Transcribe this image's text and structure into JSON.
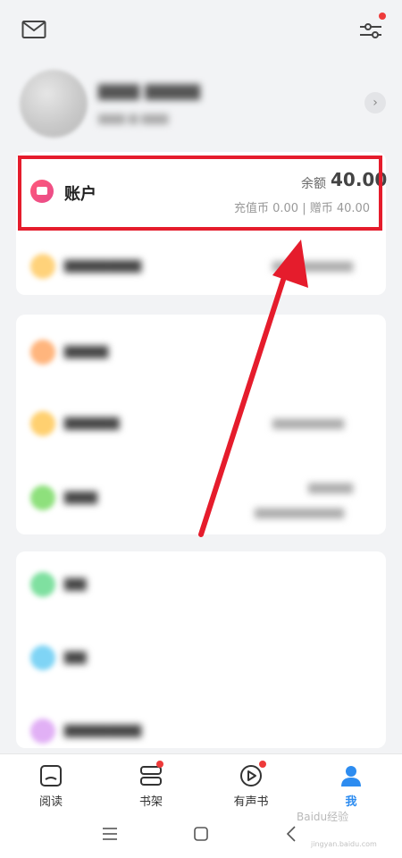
{
  "account": {
    "title": "账户",
    "balance_label": "余额",
    "balance_value": "40.00",
    "coins_text": "充值币 0.00 | 赠币 40.00"
  },
  "tabs": [
    {
      "label": "阅读",
      "icon": "book-icon",
      "badge": false,
      "active": false
    },
    {
      "label": "书架",
      "icon": "bookshelf-icon",
      "badge": true,
      "active": false
    },
    {
      "label": "有声书",
      "icon": "audiobook-play-icon",
      "badge": true,
      "active": false
    },
    {
      "label": "我",
      "icon": "person-icon",
      "badge": false,
      "active": true
    }
  ],
  "watermark": {
    "text": "Baidu经验",
    "sub": "jingyan.baidu.com"
  },
  "colors": {
    "highlight": "#e51c2c",
    "active_tab": "#2d8cf0",
    "badge": "#ee3a3a"
  }
}
